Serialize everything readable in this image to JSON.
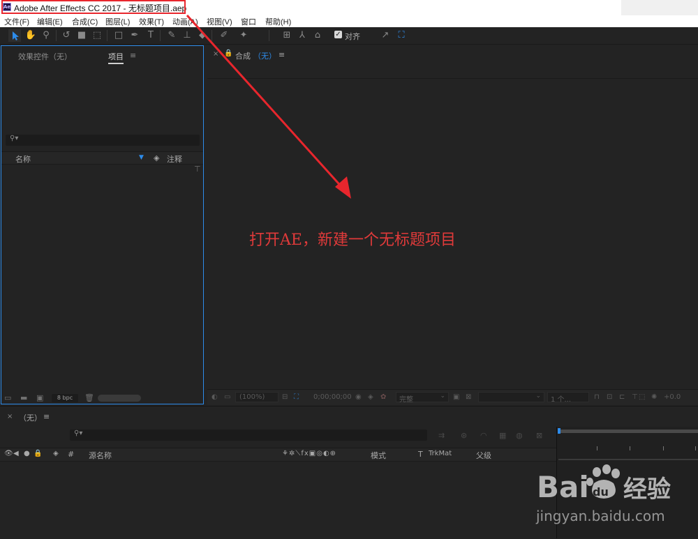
{
  "window": {
    "title": "Adobe After Effects CC 2017 - 无标题项目.aep",
    "app_icon_text": "Ae"
  },
  "menu": {
    "items": [
      "文件(F)",
      "编辑(E)",
      "合成(C)",
      "图层(L)",
      "效果(T)",
      "动画(A)",
      "视图(V)",
      "窗口",
      "帮助(H)"
    ]
  },
  "toolbar": {
    "snap_label": "对齐",
    "snap_checked": true,
    "accent_color": "#2d8ceb"
  },
  "project_panel": {
    "tab_effects": "效果控件（无）",
    "tab_project": "项目",
    "menu_icon": "≡",
    "col_name": "名称",
    "col_comment": "注释",
    "bpc": "8 bpc"
  },
  "comp_panel": {
    "close": "×",
    "tab_prefix": "合成",
    "tab_none": "（无）",
    "menu_icon": "≡",
    "zoom": "(100%)",
    "timecode": "0;00;00;00",
    "resolution": "完整",
    "views": "1 个...",
    "exposure": "+0.0"
  },
  "annotation": {
    "text": "打开AE，新建一个无标题项目",
    "color": "#e03a3a"
  },
  "timeline": {
    "close": "×",
    "tab": "（无）",
    "menu_icon": "≡",
    "col_hash": "#",
    "col_source": "源名称",
    "col_mode": "模式",
    "col_t": "T",
    "col_trkmat": "TrkMat",
    "col_parent": "父级"
  },
  "watermark": {
    "url": "jingyan.baidu.com",
    "logo_text": "Bai经验"
  }
}
